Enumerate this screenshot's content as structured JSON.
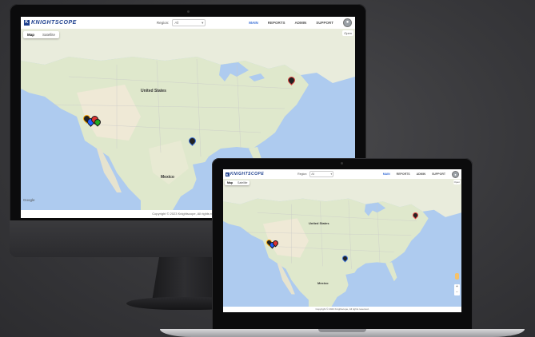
{
  "brand": {
    "name": "KNIGHTSCOPE",
    "mark": "K",
    "color": "#1d3f8e"
  },
  "header": {
    "region_label": "Region:",
    "region_value": "All",
    "nav": [
      "MAIN",
      "REPORTS",
      "ADMIN",
      "SUPPORT"
    ],
    "active_nav": "MAIN",
    "active_color": "#3a6fd6"
  },
  "map": {
    "type_options": [
      "Map",
      "Satellite"
    ],
    "selected_type": "Map",
    "open_label": "Open",
    "labels": {
      "country_us": "United States",
      "country_mx": "Mexico",
      "watermark": "Google"
    }
  },
  "footer": {
    "copyright": "Copyright © 2023 Knightscope, All rights reserved."
  },
  "icons": {
    "avatar": "user-avatar-icon",
    "pin": "robot-location-pin"
  }
}
